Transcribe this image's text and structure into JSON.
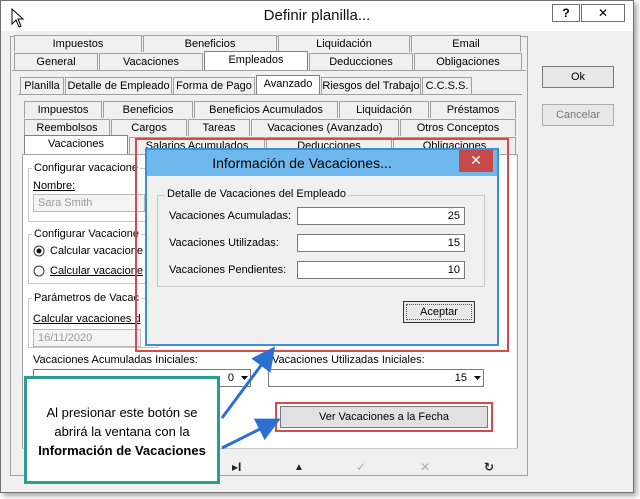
{
  "window": {
    "title": "Definir planilla...",
    "help_label": "?",
    "close_label": "✕"
  },
  "side_buttons": {
    "ok": "Ok",
    "cancel": "Cancelar"
  },
  "tabs_row1": [
    "Impuestos",
    "Beneficios",
    "Liquidación",
    "Email"
  ],
  "tabs_row2": [
    "General",
    "Vacaciones",
    "Empleados",
    "Deducciones",
    "Obligaciones"
  ],
  "tabs_row3": [
    "Planilla",
    "Detalle de Empleado",
    "Forma de Pago",
    "Avanzado",
    "Riesgos del Trabajo",
    "C.C.S.S."
  ],
  "tabs_row4": [
    "Impuestos",
    "Beneficios",
    "Beneficios Acumulados",
    "Liquidación",
    "Préstamos"
  ],
  "tabs_row5": [
    "Reembolsos",
    "Cargos",
    "Tareas",
    "Vacaciones (Avanzado)",
    "Otros Conceptos"
  ],
  "tabs_row6": [
    "Vacaciones",
    "Salarios Acumulados",
    "Deducciones",
    "Obligaciones"
  ],
  "vac_panel": {
    "group1_label": "Configurar vacacione",
    "name_label": "Nombre:",
    "name_value": "Sara Smith",
    "group2_label": "Configurar Vacacione",
    "radio1_label": "Calcular vacacione",
    "radio2_label": "Calcular vacacione",
    "group3_label": "Parámetros de Vacac",
    "calc_label": "Calcular vacaciones d",
    "date_value": "16/11/2020",
    "acum_label": "Vacaciones Acumuladas Iniciales:",
    "acum_value": "0",
    "util_label": "Vacaciones Utilizadas Iniciales:",
    "util_value": "15",
    "view_button": "Ver Vacaciones a la Fecha"
  },
  "dialog": {
    "title": "Información de Vacaciones...",
    "close_label": "✕",
    "group_label": "Detalle de Vacaciones del Empleado",
    "rows": [
      {
        "label": "Vacaciones Acumuladas:",
        "value": "25"
      },
      {
        "label": "Vacaciones Utilizadas:",
        "value": "15"
      },
      {
        "label": "Vacaciones Pendientes:",
        "value": "10"
      }
    ],
    "accept": "Aceptar"
  },
  "callout": {
    "line1": "Al presionar este botón se",
    "line2": "abrirá la ventana con la",
    "line3": "Información de Vacaciones"
  },
  "nav": {
    "last": "▸I",
    "up": "▲",
    "check": "✓",
    "cancel": "✕",
    "refresh": "↻"
  },
  "colors": {
    "highlight_red": "#d94b4b",
    "dialog_blue": "#6fb8ee",
    "callout_teal": "#2a9d8f",
    "arrow_blue": "#2b6fd1"
  }
}
